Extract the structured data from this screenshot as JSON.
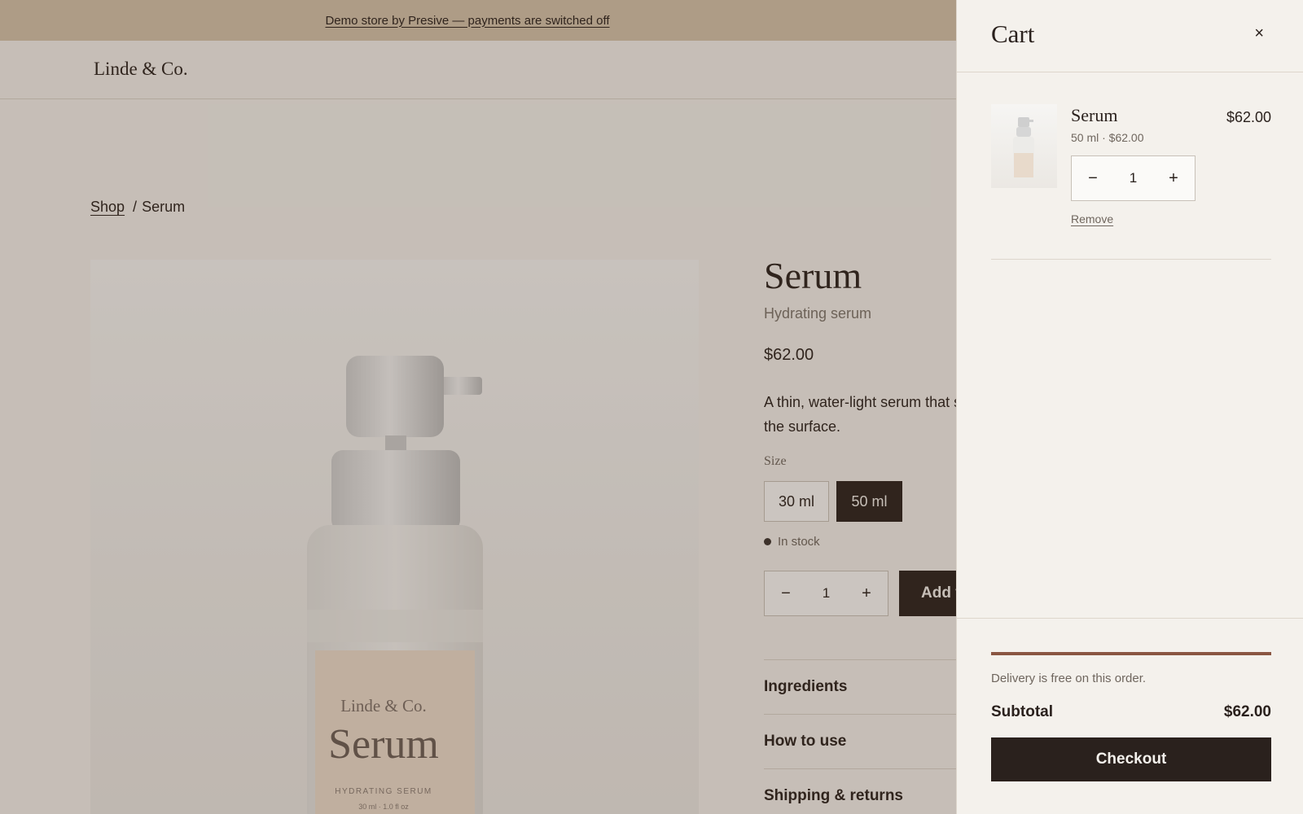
{
  "announcement": {
    "text": "Demo store by Presive — payments are switched off"
  },
  "header": {
    "logo": "Linde & Co."
  },
  "breadcrumb": {
    "shop": "Shop",
    "separator": "/",
    "current": "Serum"
  },
  "product": {
    "title": "Serum",
    "subtitle": "Hydrating serum",
    "price": "$62.00",
    "description_line1": "A thin, water-light serum that s",
    "description_line2": "the surface.",
    "size_label": "Size",
    "sizes": [
      {
        "label": "30 ml",
        "selected": false
      },
      {
        "label": "50 ml",
        "selected": true
      }
    ],
    "stock": "In stock",
    "quantity": "1",
    "add_button": "Add t",
    "accordions": [
      "Ingredients",
      "How to use",
      "Shipping & returns"
    ],
    "bottle_label": {
      "brand": "Linde & Co.",
      "name": "Serum",
      "type": "HYDRATING SERUM",
      "size": "30 ml · 1.0 fl oz"
    }
  },
  "cart": {
    "title": "Cart",
    "close_icon": "close-icon",
    "item": {
      "name": "Serum",
      "meta": "50 ml · $62.00",
      "price": "$62.00",
      "quantity": "1",
      "remove": "Remove"
    },
    "free_delivery_progress": 1.0,
    "delivery_note": "Delivery is free on this order.",
    "subtotal_label": "Subtotal",
    "subtotal_value": "$62.00",
    "checkout": "Checkout"
  },
  "icons": {
    "minus": "−",
    "plus": "+",
    "close": "×"
  },
  "colors": {
    "dark": "#2a211d",
    "accent": "#8a5642",
    "background": "#f4f1ec",
    "announcement": "#d4c3ab"
  }
}
